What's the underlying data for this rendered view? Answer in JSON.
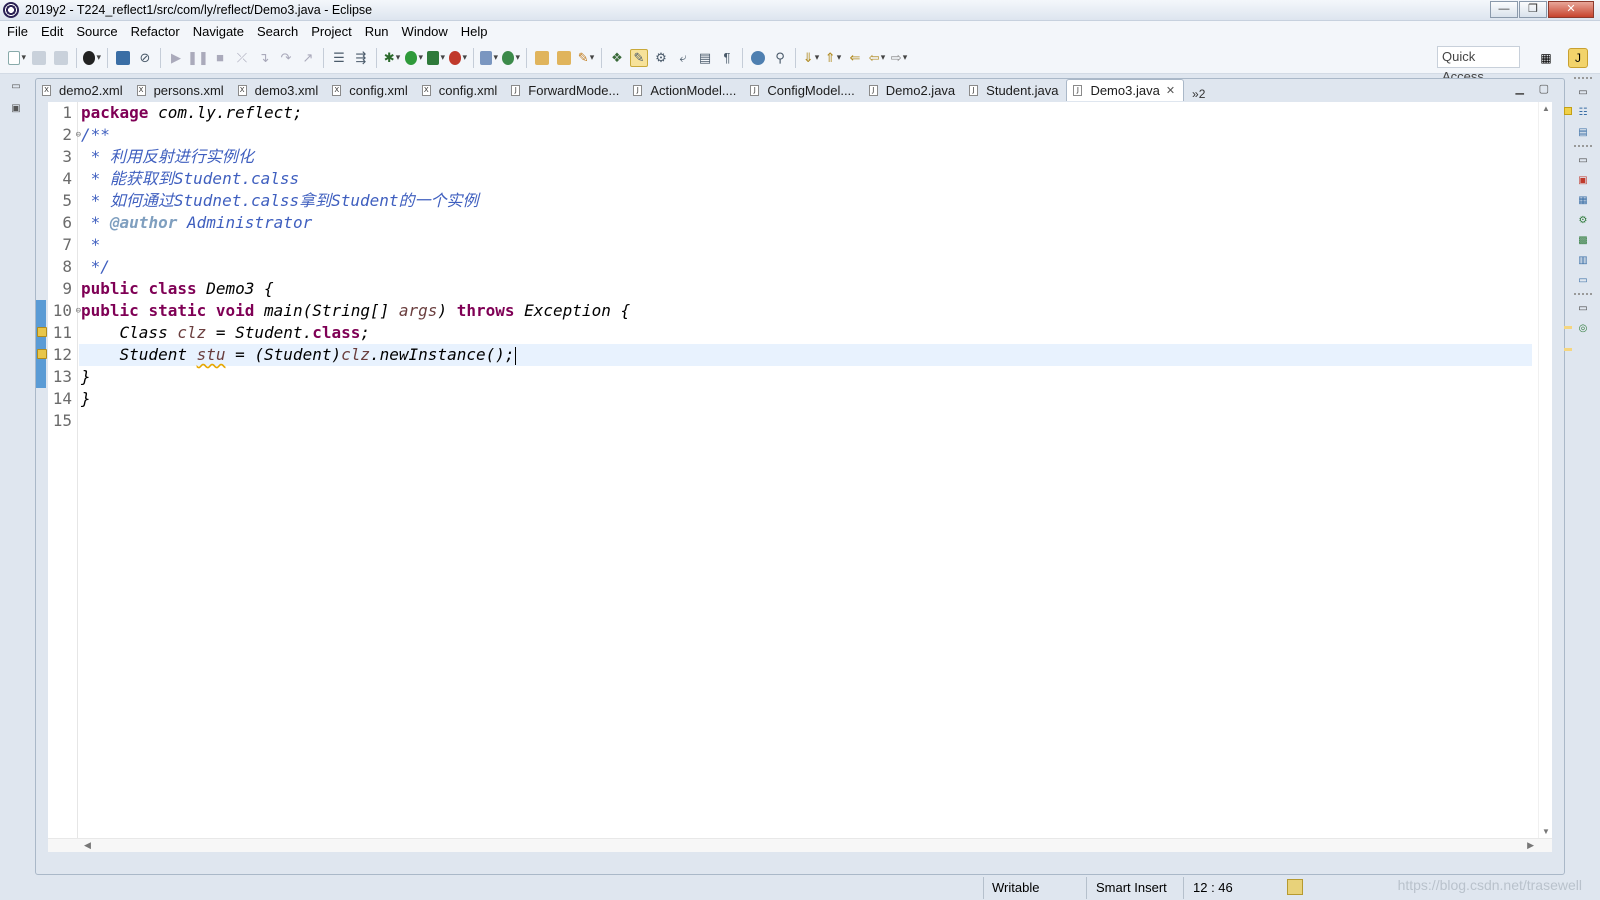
{
  "window": {
    "title": "2019y2 - T224_reflect1/src/com/ly/reflect/Demo3.java - Eclipse",
    "minimize": "—",
    "maximize": "❐",
    "close": "✕"
  },
  "menu": [
    "File",
    "Edit",
    "Source",
    "Refactor",
    "Navigate",
    "Search",
    "Project",
    "Run",
    "Window",
    "Help"
  ],
  "toolbar": {
    "quick_access": "Quick Access"
  },
  "tabs": [
    {
      "label": "demo2.xml",
      "kind": "X"
    },
    {
      "label": "persons.xml",
      "kind": "X"
    },
    {
      "label": "demo3.xml",
      "kind": "X"
    },
    {
      "label": "config.xml",
      "kind": "X"
    },
    {
      "label": "config.xml",
      "kind": "X"
    },
    {
      "label": "ForwardMode...",
      "kind": "J"
    },
    {
      "label": "ActionModel....",
      "kind": "J"
    },
    {
      "label": "ConfigModel....",
      "kind": "J"
    },
    {
      "label": "Demo2.java",
      "kind": "J"
    },
    {
      "label": "Student.java",
      "kind": "J"
    },
    {
      "label": "Demo3.java",
      "kind": "J",
      "active": true
    }
  ],
  "tab_overflow": "»2",
  "editor": {
    "line_numbers": [
      "1",
      "2",
      "3",
      "4",
      "5",
      "6",
      "7",
      "8",
      "9",
      "10",
      "11",
      "12",
      "13",
      "14",
      "15"
    ],
    "lines": {
      "l1_kw": "package",
      "l1_rest": " com.ly.reflect;",
      "l2": "/**",
      "l3": " * 利用反射进行实例化",
      "l4": " * 能获取到Student.calss",
      "l5": " * 如何通过Studnet.calss拿到Student的一个实例",
      "l6_star": " * ",
      "l6_tag": "@author",
      "l6_rest": " Administrator",
      "l7": " *",
      "l8": " */",
      "l9_kw1": "public",
      "l9_kw2": "class",
      "l9_rest": " Demo3 {",
      "l10_kw1": "public",
      "l10_kw2": "static",
      "l10_kw3": "void",
      "l10_sig": " main(String[] ",
      "l10_param": "args",
      "l10_close": ") ",
      "l10_kw4": "throws",
      "l10_rest": " Exception {",
      "l11_indent": "    ",
      "l11_type": "Class ",
      "l11_var": "clz",
      "l11_mid": " = Student.",
      "l11_kw": "class",
      "l11_end": ";",
      "l12_indent": "    ",
      "l12_type": "Student ",
      "l12_var": "stu",
      "l12_mid": " = (Student)",
      "l12_var2": "clz",
      "l12_end": ".newInstance();",
      "l13": "}",
      "l14": "}",
      "l15": ""
    }
  },
  "status": {
    "writable": "Writable",
    "insert_mode": "Smart Insert",
    "cursor_position": "12 : 46",
    "watermark": "https://blog.csdn.net/trasewell"
  }
}
